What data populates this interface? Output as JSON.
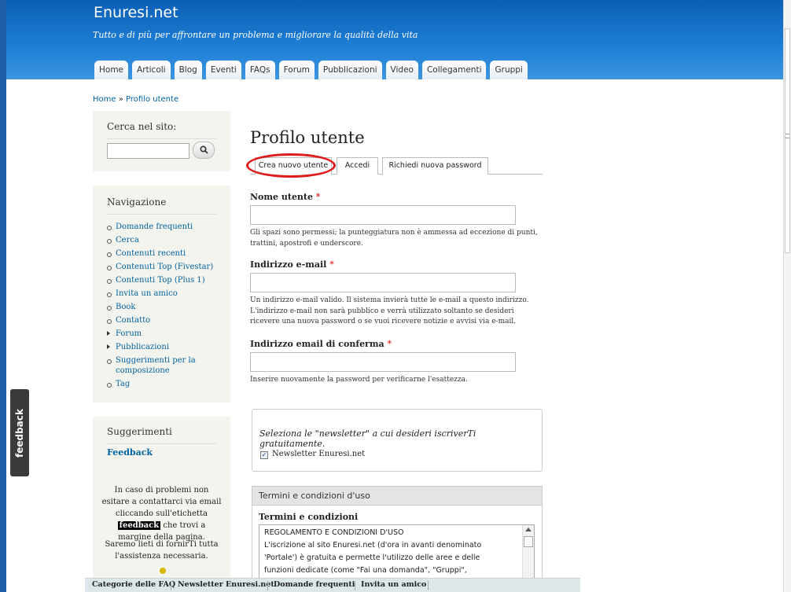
{
  "header": {
    "site_name": "Enuresi.net",
    "slogan": "Tutto e di più per affrontare un problema e migliorare la qualità della vita",
    "tabs": [
      "Home",
      "Articoli",
      "Blog",
      "Eventi",
      "FAQs",
      "Forum",
      "Pubblicazioni",
      "Video",
      "Collegamenti",
      "Gruppi"
    ]
  },
  "breadcrumb": {
    "home": "Home",
    "separator": "»",
    "current": "Profilo utente"
  },
  "search": {
    "title": "Cerca nel sito:",
    "value": "",
    "button_icon": "search-icon"
  },
  "navigation": {
    "title": "Navigazione",
    "items": [
      {
        "label": "Domande frequenti",
        "type": "leaf"
      },
      {
        "label": "Cerca",
        "type": "leaf"
      },
      {
        "label": "Contenuti recenti",
        "type": "leaf"
      },
      {
        "label": "Contenuti Top (Fivestar)",
        "type": "leaf"
      },
      {
        "label": "Contenuti Top (Plus 1)",
        "type": "leaf"
      },
      {
        "label": "Invita un amico",
        "type": "leaf"
      },
      {
        "label": "Book",
        "type": "leaf"
      },
      {
        "label": "Contatto",
        "type": "leaf"
      },
      {
        "label": "Forum",
        "type": "collapsed"
      },
      {
        "label": "Pubblicazioni",
        "type": "collapsed"
      },
      {
        "label": "Suggerimenti per la composizione",
        "type": "leaf"
      },
      {
        "label": "Tag",
        "type": "leaf"
      }
    ]
  },
  "suggestions": {
    "title": "Suggerimenti",
    "link": "Feedback",
    "text1_a": "In caso di problemi non esitare a contattarci via email cliccando sull'etichetta",
    "text1_badge": "feedback",
    "text1_b": "che trovi a margine della pagina.",
    "text2": "Saremo lieti di fornirTi tutta l'assistenza necessaria."
  },
  "feedback_tab": "feedback",
  "main": {
    "title": "Profilo utente",
    "tabs": [
      "Crea nuovo utente",
      "Accedi",
      "Richiedi nuova password"
    ],
    "fields": {
      "username": {
        "label": "Nome utente",
        "required": "*",
        "value": "",
        "description": "Gli spazi sono permessi; la punteggiatura non è ammessa ad eccezione di punti, trattini, apostrofi e underscore."
      },
      "email": {
        "label": "Indirizzo e-mail",
        "required": "*",
        "value": "",
        "description": "Un indirizzo e-mail valido. Il sistema invierà tutte le e-mail a questo indirizzo. L'indirizzo e-mail non sarà pubblico e verrà utilizzato soltanto se desideri ricevere una nuova password o se vuoi ricevere notizie e avvisi via e-mail."
      },
      "email_confirm": {
        "label": "Indirizzo email di conferma",
        "required": "*",
        "value": "",
        "description": "Inserire nuovamente la password per verificarne l'esattezza."
      }
    },
    "newsletter": {
      "intro": "Seleziona le \"newsletter\" a cui desideri iscriverTi gratuitamente.",
      "checkbox_label": "Newsletter Enuresi.net",
      "checked": true,
      "check_mark": "✓"
    },
    "terms": {
      "section_title": "Termini e condizioni d'uso",
      "label": "Termini e condizioni",
      "lines": [
        "REGOLAMENTO E CONDIZIONI D'USO",
        "L'iscrizione al sito Enuresi.net (d'ora in avanti denominato",
        "'Portale') è gratuita e permette l'utilizzo delle aree e delle",
        "funzioni dedicate (come \"Fai una domanda\", \"Gruppi\","
      ]
    }
  },
  "bottom_bar": [
    "Categorie delle FAQ",
    "Newsletter Enuresi.net",
    "Domande frequenti",
    "Invita un amico"
  ],
  "colors": {
    "header_blue": "#1e7fd6",
    "link": "#0062a0",
    "highlight_oval": "#dd1d1d",
    "required": "#dd0000"
  }
}
